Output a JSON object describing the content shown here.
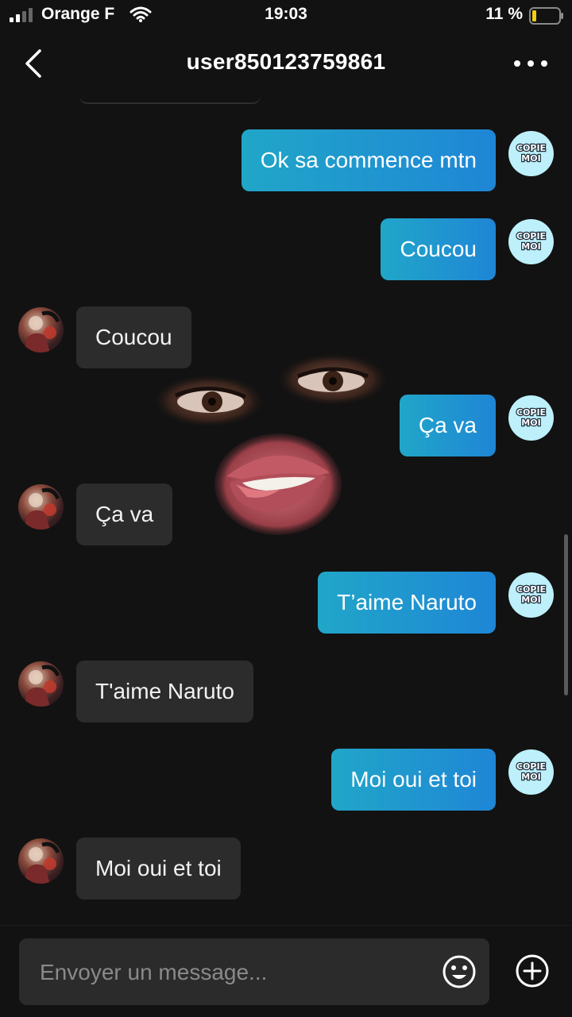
{
  "status_bar": {
    "carrier": "Orange F",
    "time": "19:03",
    "battery": "11 %",
    "signal_icon": "signal-bars-icon",
    "wifi_icon": "wifi-icon",
    "battery_icon": "battery-low-icon"
  },
  "header": {
    "title": "user850123759861",
    "back_icon": "chevron-left-icon",
    "more_icon": "more-horizontal-icon"
  },
  "avatars": {
    "me_text_line1": "COPIE",
    "me_text_line2": "MOI"
  },
  "messages": [
    {
      "from": "me",
      "text": "Ok sa commence mtn"
    },
    {
      "from": "me",
      "text": "Coucou"
    },
    {
      "from": "other",
      "text": "Coucou"
    },
    {
      "from": "me",
      "text": "Ça va"
    },
    {
      "from": "other",
      "text": "Ça va"
    },
    {
      "from": "me",
      "text": "T’aime Naruto"
    },
    {
      "from": "other",
      "text": "T'aime Naruto"
    },
    {
      "from": "me",
      "text": "Moi oui et toi"
    },
    {
      "from": "other",
      "text": "Moi oui et toi"
    }
  ],
  "input": {
    "placeholder": "Envoyer un message...",
    "value": "",
    "emoji_icon": "emoji-smile-icon",
    "plus_icon": "plus-circle-icon"
  },
  "colors": {
    "background": "#121212",
    "sent_bubble_start": "#20a6c8",
    "sent_bubble_end": "#1f86d6",
    "received_bubble": "#2c2c2c",
    "battery_low": "#f2d00f",
    "avatar_me_bg": "#bdf0fa"
  }
}
